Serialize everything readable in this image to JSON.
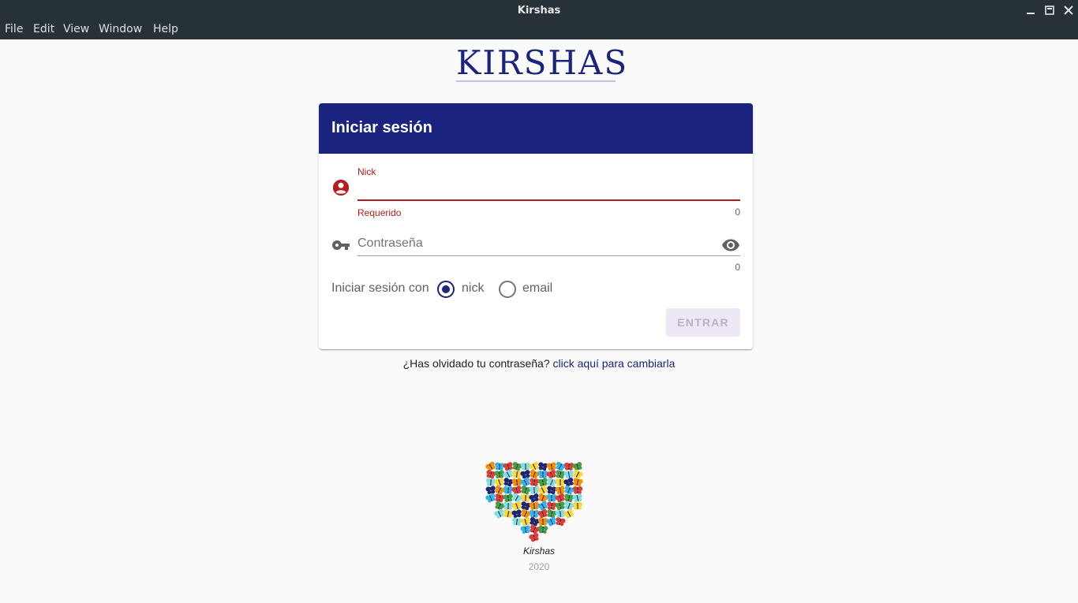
{
  "window": {
    "title": "Kirshas"
  },
  "menu": {
    "file": "File",
    "edit": "Edit",
    "view": "View",
    "window": "Window",
    "help": "Help"
  },
  "logo": {
    "text": "KIRSHAS"
  },
  "login": {
    "title": "Iniciar sesión",
    "nick": {
      "label": "Nick",
      "value": "",
      "error": "Requerido",
      "counter": "0"
    },
    "password": {
      "placeholder": "Contraseña",
      "value": "",
      "counter": "0"
    },
    "mode": {
      "label": "Iniciar sesión con",
      "options": [
        "nick",
        "email"
      ],
      "selected": "nick"
    },
    "submit": "ENTRAR"
  },
  "forgot": {
    "question": "¿Has olvidado tu contraseña?",
    "link": "click aquí para cambiarla"
  },
  "footer": {
    "name": "Kirshas",
    "year": "2020"
  },
  "colors": {
    "primary": "#1a237e",
    "error": "#b71c1c",
    "titlebar": "#263238",
    "button_disabled_bg": "#ede7f6"
  },
  "icons": [
    "minimize-icon",
    "maximize-icon",
    "close-icon",
    "account-circle-icon",
    "key-icon",
    "eye-icon",
    "butterfly-heart-logo"
  ]
}
